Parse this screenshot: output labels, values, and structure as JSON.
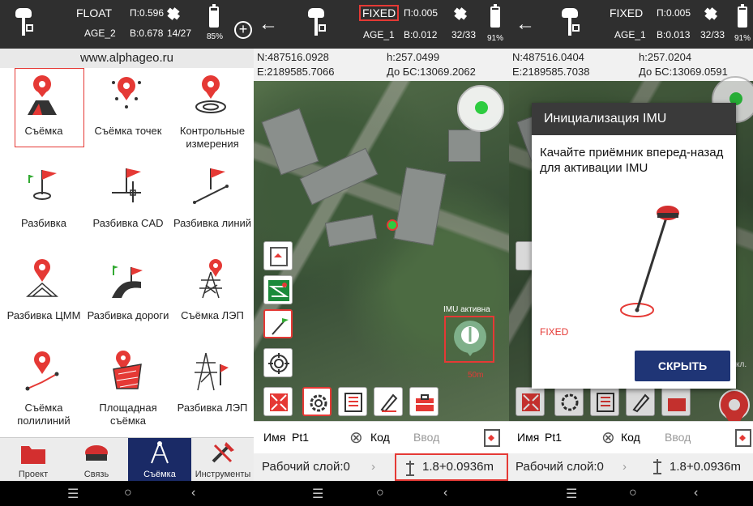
{
  "panel1": {
    "status": {
      "mode": "FLOAT",
      "accuracy_h": "П:0.596",
      "age": "AGE_2",
      "accuracy_v": "В:0.678",
      "sats": "14/27",
      "battery": "85%",
      "battery_level": 0.85
    },
    "url": "www.alphageo.ru",
    "grid_items": [
      {
        "label": "Съёмка"
      },
      {
        "label": "Съёмка точек"
      },
      {
        "label": "Контрольные измерения"
      },
      {
        "label": "Разбивка"
      },
      {
        "label": "Разбивка CAD"
      },
      {
        "label": "Разбивка линий"
      },
      {
        "label": "Разбивка ЦММ"
      },
      {
        "label": "Разбивка дороги"
      },
      {
        "label": "Съёмка ЛЭП"
      },
      {
        "label": "Съёмка полилиний"
      },
      {
        "label": "Площадная съёмка"
      },
      {
        "label": "Разбивка ЛЭП"
      }
    ],
    "tabs": [
      {
        "label": "Проект"
      },
      {
        "label": "Связь"
      },
      {
        "label": "Съёмка"
      },
      {
        "label": "Инструменты"
      }
    ]
  },
  "panel2": {
    "status": {
      "mode": "FIXED",
      "accuracy_h": "П:0.005",
      "age": "AGE_1",
      "accuracy_v": "В:0.012",
      "sats": "32/33",
      "battery": "91%",
      "battery_level": 0.91
    },
    "coords": {
      "n": "N:487516.0928",
      "e": "E:2189585.7066",
      "h": "h:257.0499",
      "base": "До БС:13069.2062"
    },
    "imu_label": "IMU активна",
    "scale": "50m",
    "input": {
      "name_label": "Имя",
      "name_value": "Pt1",
      "code_label": "Код",
      "code_placeholder": "Ввод"
    },
    "work": {
      "layer": "Рабочий слой:0",
      "height": "1.8+0.0936m"
    }
  },
  "panel3": {
    "status": {
      "mode": "FIXED",
      "accuracy_h": "П:0.005",
      "age": "AGE_1",
      "accuracy_v": "В:0.013",
      "sats": "32/33",
      "battery": "91%",
      "battery_level": 0.91
    },
    "coords": {
      "n": "N:487516.0404",
      "e": "E:2189585.7038",
      "h": "h:257.0204",
      "base": "До БС:13069.0591"
    },
    "dialog": {
      "title": "Инициализация IMU",
      "text": "Качайте приёмник вперед-назад для активации IMU",
      "fix_status": "FIXED",
      "button": "СКРЫТЬ"
    },
    "input": {
      "name_label": "Имя",
      "name_value": "Pt1",
      "code_label": "Код",
      "code_placeholder": "Ввод"
    },
    "work": {
      "layer": "Рабочий слой:0",
      "height": "1.8+0.0936m"
    },
    "edge_label": "кл."
  },
  "navbar": {
    "recent": "☰",
    "home": "○",
    "back": "‹"
  },
  "colors": {
    "accent": "#e53935",
    "nav_active": "#1a2a66",
    "button": "#1f3576"
  }
}
